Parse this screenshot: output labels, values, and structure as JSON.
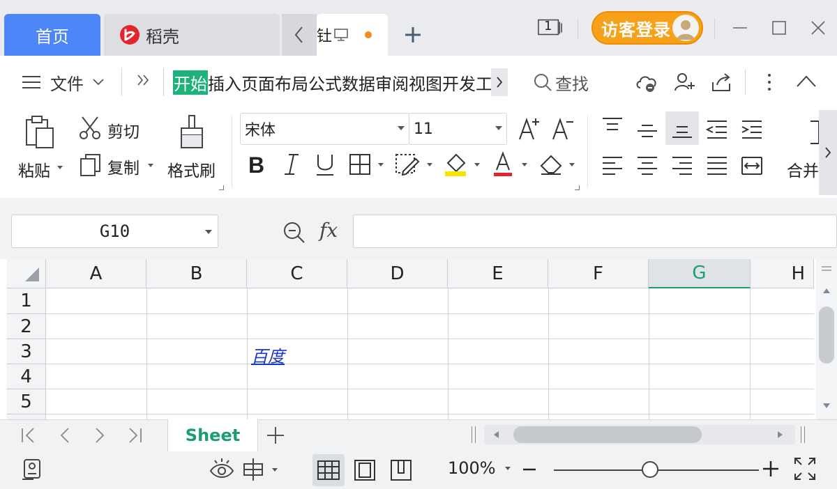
{
  "tabs": {
    "home": "首页",
    "doc": "稻壳",
    "active_fragment": "钍"
  },
  "titlebar": {
    "window_count": "1",
    "login_label": "访客登录"
  },
  "menu": {
    "file_label": "文件",
    "ribbon_tabs": [
      "开始",
      "插入",
      "页面布局",
      "公式",
      "数据",
      "审阅",
      "视图",
      "开发工"
    ],
    "active_tab": "开始",
    "search_label": "查找"
  },
  "ribbon": {
    "paste_label": "粘贴",
    "cut_label": "剪切",
    "copy_label": "复制",
    "format_painter_label": "格式刷",
    "font_name": "宋体",
    "font_size": "11",
    "merge_label": "合并"
  },
  "formula_bar": {
    "cell_ref": "G10",
    "fx_label": "fx",
    "formula_value": ""
  },
  "grid": {
    "columns": [
      "A",
      "B",
      "C",
      "D",
      "E",
      "F",
      "G",
      "H"
    ],
    "selected_column": "G",
    "rows": [
      "1",
      "2",
      "3",
      "4",
      "5"
    ],
    "cells": {
      "C3": "百度"
    }
  },
  "sheets": {
    "tabs": [
      "Sheet"
    ],
    "active": "Sheet"
  },
  "status": {
    "zoom": "100%",
    "zoom_slider_fraction": 0.47
  },
  "colors": {
    "accent_green": "#1cb27a",
    "home_tab_blue": "#4d86f7",
    "login_orange": "#f7a11a",
    "hyperlink_blue": "#1a33c8"
  }
}
